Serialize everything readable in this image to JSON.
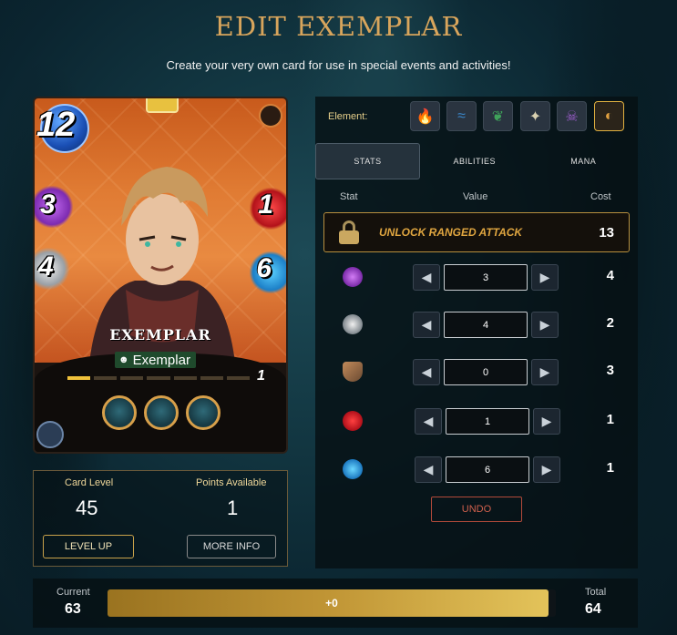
{
  "header": {
    "title": "EDIT EXEMPLAR",
    "subtitle": "Create your very own card for use in special events and activities!"
  },
  "card": {
    "mana": "12",
    "magic": "3",
    "melee": "4",
    "health": "1",
    "speed": "6",
    "name": "EXEMPLAR",
    "type_label": "Exemplar",
    "level_number": "1",
    "level_progress_segments": [
      true,
      false,
      false,
      false,
      false,
      false,
      false
    ],
    "abilities_icons": [
      "sun-blast-icon",
      "shatter-icon",
      "robot-icon"
    ],
    "colors": {
      "art_orange": "#e07b33",
      "mana_blue": "#1a4fb5"
    }
  },
  "level_panel": {
    "card_level_label": "Card Level",
    "card_level_value": "45",
    "points_label": "Points Available",
    "points_value": "1",
    "level_up_label": "LEVEL UP",
    "more_info_label": "MORE INFO"
  },
  "elements": {
    "label": "Element:",
    "items": [
      {
        "name": "fire",
        "glyph": "🔥",
        "active": false
      },
      {
        "name": "water",
        "glyph": "≈",
        "active": false
      },
      {
        "name": "earth",
        "glyph": "❦",
        "active": false
      },
      {
        "name": "life",
        "glyph": "✦",
        "active": false
      },
      {
        "name": "death",
        "glyph": "☠",
        "active": false
      },
      {
        "name": "neutral",
        "glyph": "◐",
        "active": true
      }
    ],
    "accent": "#e0b040"
  },
  "tabs": [
    {
      "label": "STATS",
      "active": true
    },
    {
      "label": "ABILITIES",
      "active": false
    },
    {
      "label": "MANA",
      "active": false
    }
  ],
  "stats_table": {
    "headers": {
      "stat": "Stat",
      "value": "Value",
      "cost": "Cost"
    },
    "unlock": {
      "label": "UNLOCK RANGED ATTACK",
      "cost": "13"
    },
    "rows": [
      {
        "icon": "magic-attack-icon",
        "value": "3",
        "cost": "4"
      },
      {
        "icon": "melee-attack-icon",
        "value": "4",
        "cost": "2"
      },
      {
        "icon": "armor-shield-icon",
        "value": "0",
        "cost": "3"
      },
      {
        "icon": "health-heart-icon",
        "value": "1",
        "cost": "1"
      },
      {
        "icon": "speed-boot-icon",
        "value": "6",
        "cost": "1"
      }
    ],
    "undo_label": "UNDO"
  },
  "bottom": {
    "current_label": "Current",
    "current_value": "63",
    "total_label": "Total",
    "total_value": "64",
    "progress_text": "+0",
    "progress_fraction": 0.984
  }
}
